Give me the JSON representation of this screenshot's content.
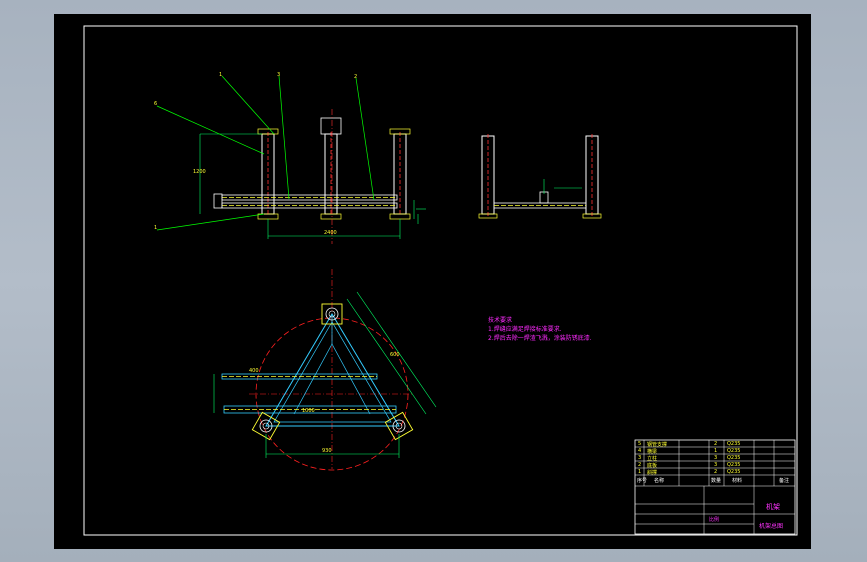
{
  "viewport": {
    "background": "#000000",
    "window_background": "#aab4c0"
  },
  "colors": {
    "frame": "#ffffff",
    "outline": "#ffffff",
    "dimension": "#00ff66",
    "leader": "#00ff00",
    "circle": "#ff2020",
    "beam": "#ffff33",
    "center_line": "#ff2020",
    "pipe_red": "#ff3030",
    "brace": "#33ccff",
    "label": "#ffff33",
    "text": "#ff33ff"
  },
  "drawing": {
    "leaders": [
      "1",
      "3",
      "2",
      "6",
      "1"
    ],
    "dimension_labels": [
      "1200",
      "2400",
      "930",
      "600",
      "1000",
      "400"
    ],
    "tech_requirements": {
      "heading": "技术要求",
      "items": [
        "1.焊缝应满足焊接标准要求.",
        "2.焊后去除一焊渣飞溅，涂装防锈底漆."
      ]
    }
  },
  "title_block": {
    "drawing_name": "机架",
    "drawing_no": "机架总图",
    "scale_label": "比例",
    "parts": [
      {
        "no": "5",
        "name": "钢管支撑",
        "qty": "2",
        "material": "Q235"
      },
      {
        "no": "4",
        "name": "横梁",
        "qty": "1",
        "material": "Q235"
      },
      {
        "no": "3",
        "name": "立柱",
        "qty": "3",
        "material": "Q235"
      },
      {
        "no": "2",
        "name": "底板",
        "qty": "3",
        "material": "Q235"
      },
      {
        "no": "1",
        "name": "斜撑",
        "qty": "2",
        "material": "Q235"
      }
    ],
    "headers": [
      "序号",
      "名称",
      "数量",
      "材料",
      "备注"
    ]
  }
}
